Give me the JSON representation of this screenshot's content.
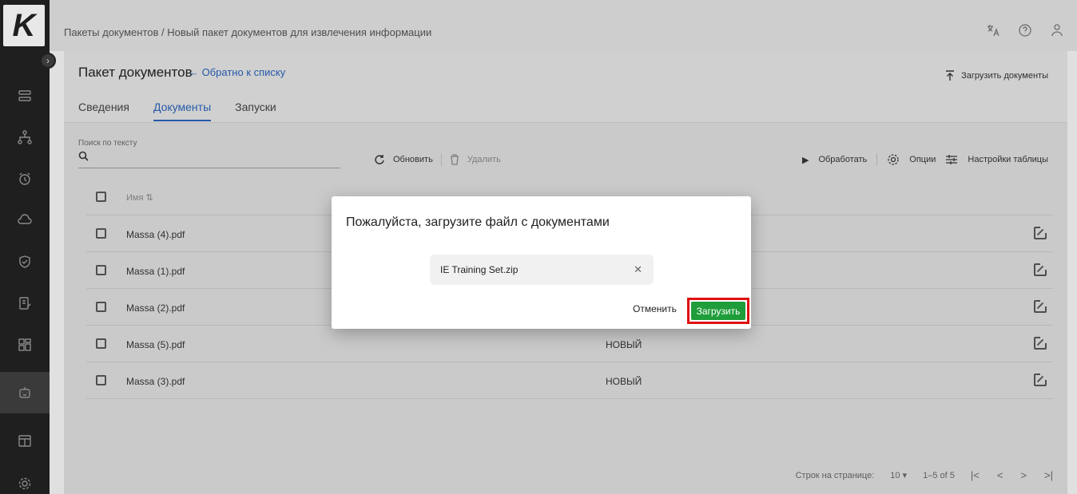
{
  "app": {
    "logo_letter": "K"
  },
  "header": {
    "breadcrumb": "Пакеты документов / Новый пакет документов для извлечения информации"
  },
  "page": {
    "title": "Пакет документов",
    "back_link": "← Обратно к списку",
    "upload_docs": "Загрузить документы",
    "tabs": [
      "Сведения",
      "Документы",
      "Запуски"
    ]
  },
  "toolbar": {
    "search_label": "Поиск по тексту",
    "refresh": "Обновить",
    "delete": "Удалить",
    "process": "Обработать",
    "options": "Опции",
    "table_settings": "Настройки таблицы"
  },
  "table": {
    "name_header": "Имя ⇅",
    "rows": [
      {
        "name": "Massa (4).pdf",
        "status": ""
      },
      {
        "name": "Massa (1).pdf",
        "status": ""
      },
      {
        "name": "Massa (2).pdf",
        "status": ""
      },
      {
        "name": "Massa (5).pdf",
        "status": "НОВЫЙ"
      },
      {
        "name": "Massa (3).pdf",
        "status": "НОВЫЙ"
      }
    ]
  },
  "pagination": {
    "rows_per_page_label": "Строк на странице:",
    "rows_per_page": "10 ▾",
    "range": "1–5 of 5"
  },
  "dialog": {
    "title": "Пожалуйста, загрузите файл с документами",
    "file_name": "IE Training Set.zip",
    "cancel": "Отменить",
    "upload": "Загрузить"
  }
}
